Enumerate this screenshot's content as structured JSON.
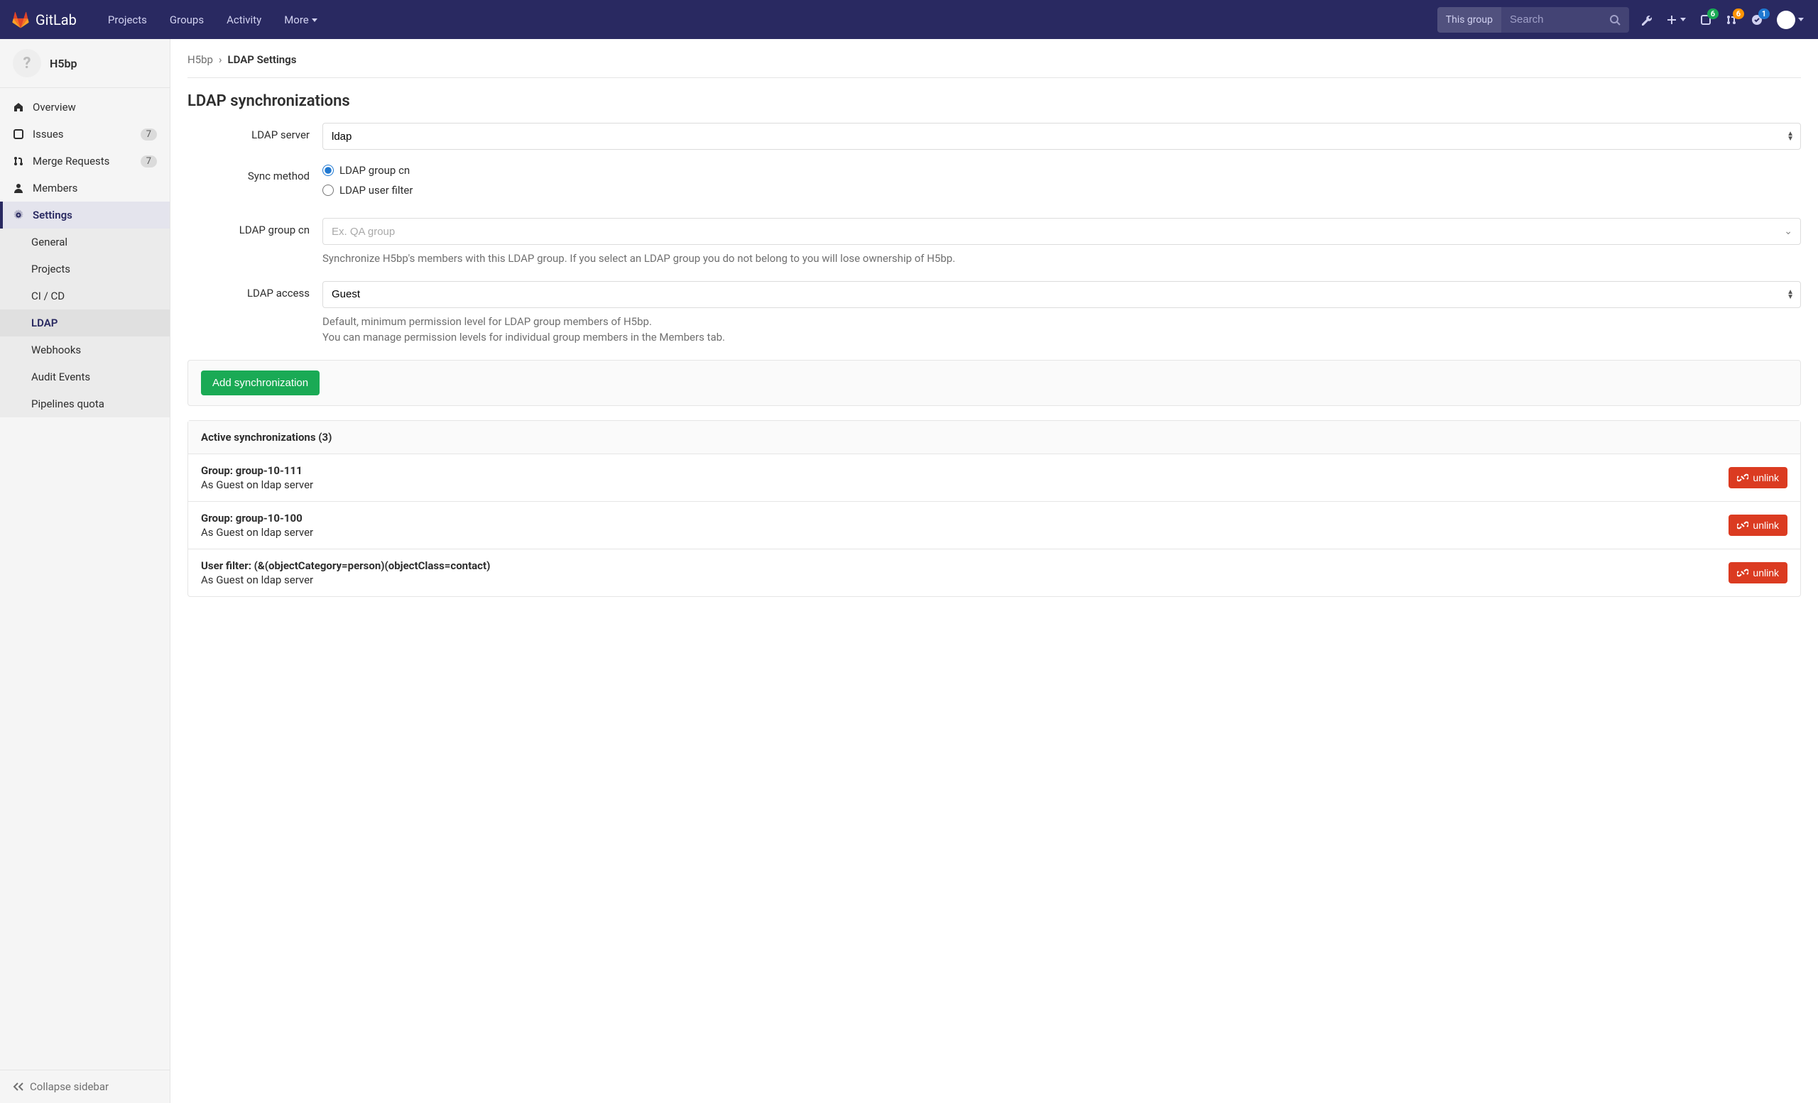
{
  "navbar": {
    "brand": "GitLab",
    "links": [
      "Projects",
      "Groups",
      "Activity",
      "More"
    ],
    "search_scope": "This group",
    "search_placeholder": "Search",
    "issues_badge": "6",
    "mr_badge": "6",
    "todos_badge": "1"
  },
  "sidebar": {
    "group_initial": "?",
    "group_name": "H5bp",
    "items": [
      {
        "label": "Overview"
      },
      {
        "label": "Issues",
        "count": "7"
      },
      {
        "label": "Merge Requests",
        "count": "7"
      },
      {
        "label": "Members"
      },
      {
        "label": "Settings"
      }
    ],
    "settings_sub": [
      "General",
      "Projects",
      "CI / CD",
      "LDAP",
      "Webhooks",
      "Audit Events",
      "Pipelines quota"
    ],
    "collapse": "Collapse sidebar"
  },
  "breadcrumb": {
    "root": "H5bp",
    "current": "LDAP Settings"
  },
  "page": {
    "title": "LDAP synchronizations",
    "ldap_server_label": "LDAP server",
    "ldap_server_value": "ldap",
    "sync_method_label": "Sync method",
    "sync_method_options": [
      "LDAP group cn",
      "LDAP user filter"
    ],
    "ldap_group_cn_label": "LDAP group cn",
    "ldap_group_cn_placeholder": "Ex. QA group",
    "ldap_group_cn_help": "Synchronize H5bp's members with this LDAP group. If you select an LDAP group you do not belong to you will lose ownership of H5bp.",
    "ldap_access_label": "LDAP access",
    "ldap_access_value": "Guest",
    "ldap_access_help1": "Default, minimum permission level for LDAP group members of H5bp.",
    "ldap_access_help2": "You can manage permission levels for individual group members in the Members tab.",
    "add_button": "Add synchronization"
  },
  "active": {
    "header": "Active synchronizations (3)",
    "rows": [
      {
        "title": "Group: group-10-111",
        "sub": "As Guest on ldap server"
      },
      {
        "title": "Group: group-10-100",
        "sub": "As Guest on ldap server"
      },
      {
        "title": "User filter: (&(objectCategory=person)(objectClass=contact)",
        "sub": "As Guest on ldap server"
      }
    ],
    "unlink_label": "unlink"
  }
}
